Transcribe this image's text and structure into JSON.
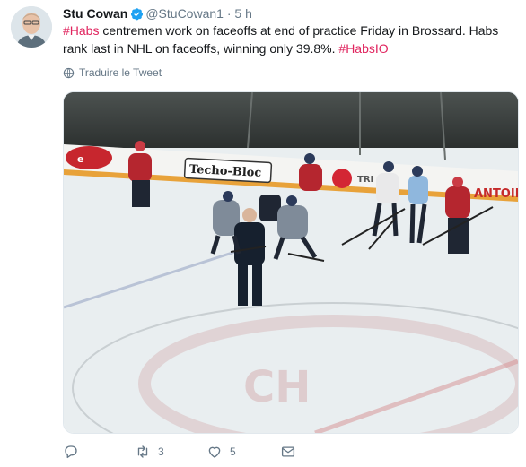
{
  "author": {
    "name": "Stu Cowan",
    "handle": "@StuCowan1",
    "separator": "·",
    "time": "5 h"
  },
  "tweet": {
    "tag1": "#Habs",
    "text": " centremen work on faceoffs at end of practice Friday in Brossard. Habs rank last in NHL on faceoffs, winning only 39.8%. ",
    "tag2": "#HabsIO"
  },
  "translate_label": "Traduire le Tweet",
  "image_signage": {
    "board1": "Techo-Bloc",
    "board2": "ANTOIN",
    "board3": "TRI"
  },
  "actions": {
    "reply_count": "",
    "retweet_count": "3",
    "like_count": "5"
  },
  "colors": {
    "hashtag": "#e0245e",
    "verified": "#1da1f2",
    "ice": "#e9eef0",
    "jersey_red": "#b5262f"
  }
}
